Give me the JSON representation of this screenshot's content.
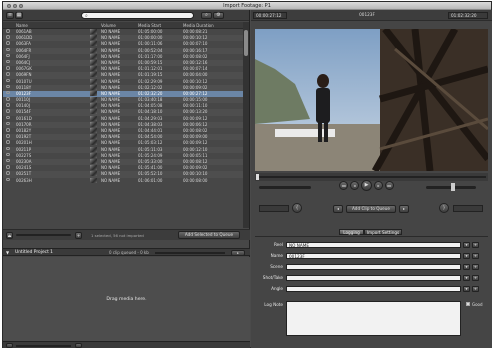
{
  "window": {
    "title": "Import Footage: P1"
  },
  "left": {
    "search": {
      "placeholder": ""
    },
    "columns": {
      "name": "Name",
      "volume": "Volume",
      "media_start": "Media Start",
      "media_duration": "Media Duration"
    },
    "rows": [
      {
        "name": "0061AB",
        "volume": "NO NAME",
        "start": "01:05:00:00",
        "dur": "00:00:08:21"
      },
      {
        "name": "0061DD",
        "volume": "NO NAME",
        "start": "01:00:00:00",
        "dur": "00:00:10:12"
      },
      {
        "name": "0063FA",
        "volume": "NO NAME",
        "start": "01:00:11:06",
        "dur": "00:00:07:10"
      },
      {
        "name": "0064FR",
        "volume": "NO NAME",
        "start": "01:00:52:04",
        "dur": "00:00:16:17"
      },
      {
        "name": "0064FJ",
        "volume": "NO NAME",
        "start": "01:01:17:00",
        "dur": "00:00:08:02"
      },
      {
        "name": "0064CJ",
        "volume": "NO NAME",
        "start": "01:00:59:15",
        "dur": "00:00:12:16"
      },
      {
        "name": "0067GK",
        "volume": "NO NAME",
        "start": "01:01:12:01",
        "dur": "00:00:07:14"
      },
      {
        "name": "0069FN",
        "volume": "NO NAME",
        "start": "01:01:19:15",
        "dur": "00:00:04:00"
      },
      {
        "name": "00107U",
        "volume": "NO NAME",
        "start": "01:02:29:09",
        "dur": "00:00:10:12"
      },
      {
        "name": "00118Y",
        "volume": "NO NAME",
        "start": "01:02:12:02",
        "dur": "00:00:09:02"
      },
      {
        "name": "00123F",
        "volume": "NO NAME",
        "start": "01:02:32:20",
        "dur": "00:00:27:12"
      },
      {
        "name": "00110J",
        "volume": "NO NAME",
        "start": "01:03:40:18",
        "dur": "00:00:15:00"
      },
      {
        "name": "00140J",
        "volume": "NO NAME",
        "start": "01:04:05:08",
        "dur": "00:00:11:10"
      },
      {
        "name": "00154F",
        "volume": "NO NAME",
        "start": "01:04:18:10",
        "dur": "00:00:13:20"
      },
      {
        "name": "00161D",
        "volume": "NO NAME",
        "start": "01:04:29:03",
        "dur": "00:00:09:12"
      },
      {
        "name": "00170R",
        "volume": "NO NAME",
        "start": "01:04:38:03",
        "dur": "00:00:06:12"
      },
      {
        "name": "00182Y",
        "volume": "NO NAME",
        "start": "01:04:44:01",
        "dur": "00:00:08:02"
      },
      {
        "name": "00192T",
        "volume": "NO NAME",
        "start": "01:04:54:00",
        "dur": "00:00:09:00"
      },
      {
        "name": "00201H",
        "volume": "NO NAME",
        "start": "01:05:03:12",
        "dur": "00:00:09:12"
      },
      {
        "name": "00211P",
        "volume": "NO NAME",
        "start": "01:05:11:03",
        "dur": "00:00:12:10"
      },
      {
        "name": "00227S",
        "volume": "NO NAME",
        "start": "01:05:24:09",
        "dur": "00:00:05:11"
      },
      {
        "name": "00230A",
        "volume": "NO NAME",
        "start": "01:05:33:00",
        "dur": "00:00:08:12"
      },
      {
        "name": "00241S",
        "volume": "NO NAME",
        "start": "01:05:41:00",
        "dur": "00:00:09:02"
      },
      {
        "name": "00251T",
        "volume": "NO NAME",
        "start": "01:05:52:10",
        "dur": "00:00:10:10"
      },
      {
        "name": "00263H",
        "volume": "NO NAME",
        "start": "01:06:01:00",
        "dur": "00:00:08:00"
      }
    ],
    "selected_index": 10,
    "status": "1 selected, 56 not imported",
    "add_selected": "Add Selected to Queue",
    "project_name": "Untitled Project 1",
    "project_size": "0 clip queued - 0 kb",
    "drop_hint": "Drag media here."
  },
  "right": {
    "tc_in": "00:00:27:12",
    "clip_name": "00123F",
    "tc_out": "01:02:32:20",
    "mark_in": "Mark In",
    "mark_out": "Mark Out",
    "add_clip": "Add Clip to Queue",
    "tabs": [
      "Logging",
      "Import Settings"
    ],
    "fields": [
      {
        "label": "Reel",
        "value": "NO NAME"
      },
      {
        "label": "Name",
        "value": "00123F"
      },
      {
        "label": "Scene",
        "value": ""
      },
      {
        "label": "Shot/Take",
        "value": ""
      },
      {
        "label": "Angle",
        "value": ""
      }
    ],
    "log_note": "Log Note",
    "good": "Good"
  }
}
